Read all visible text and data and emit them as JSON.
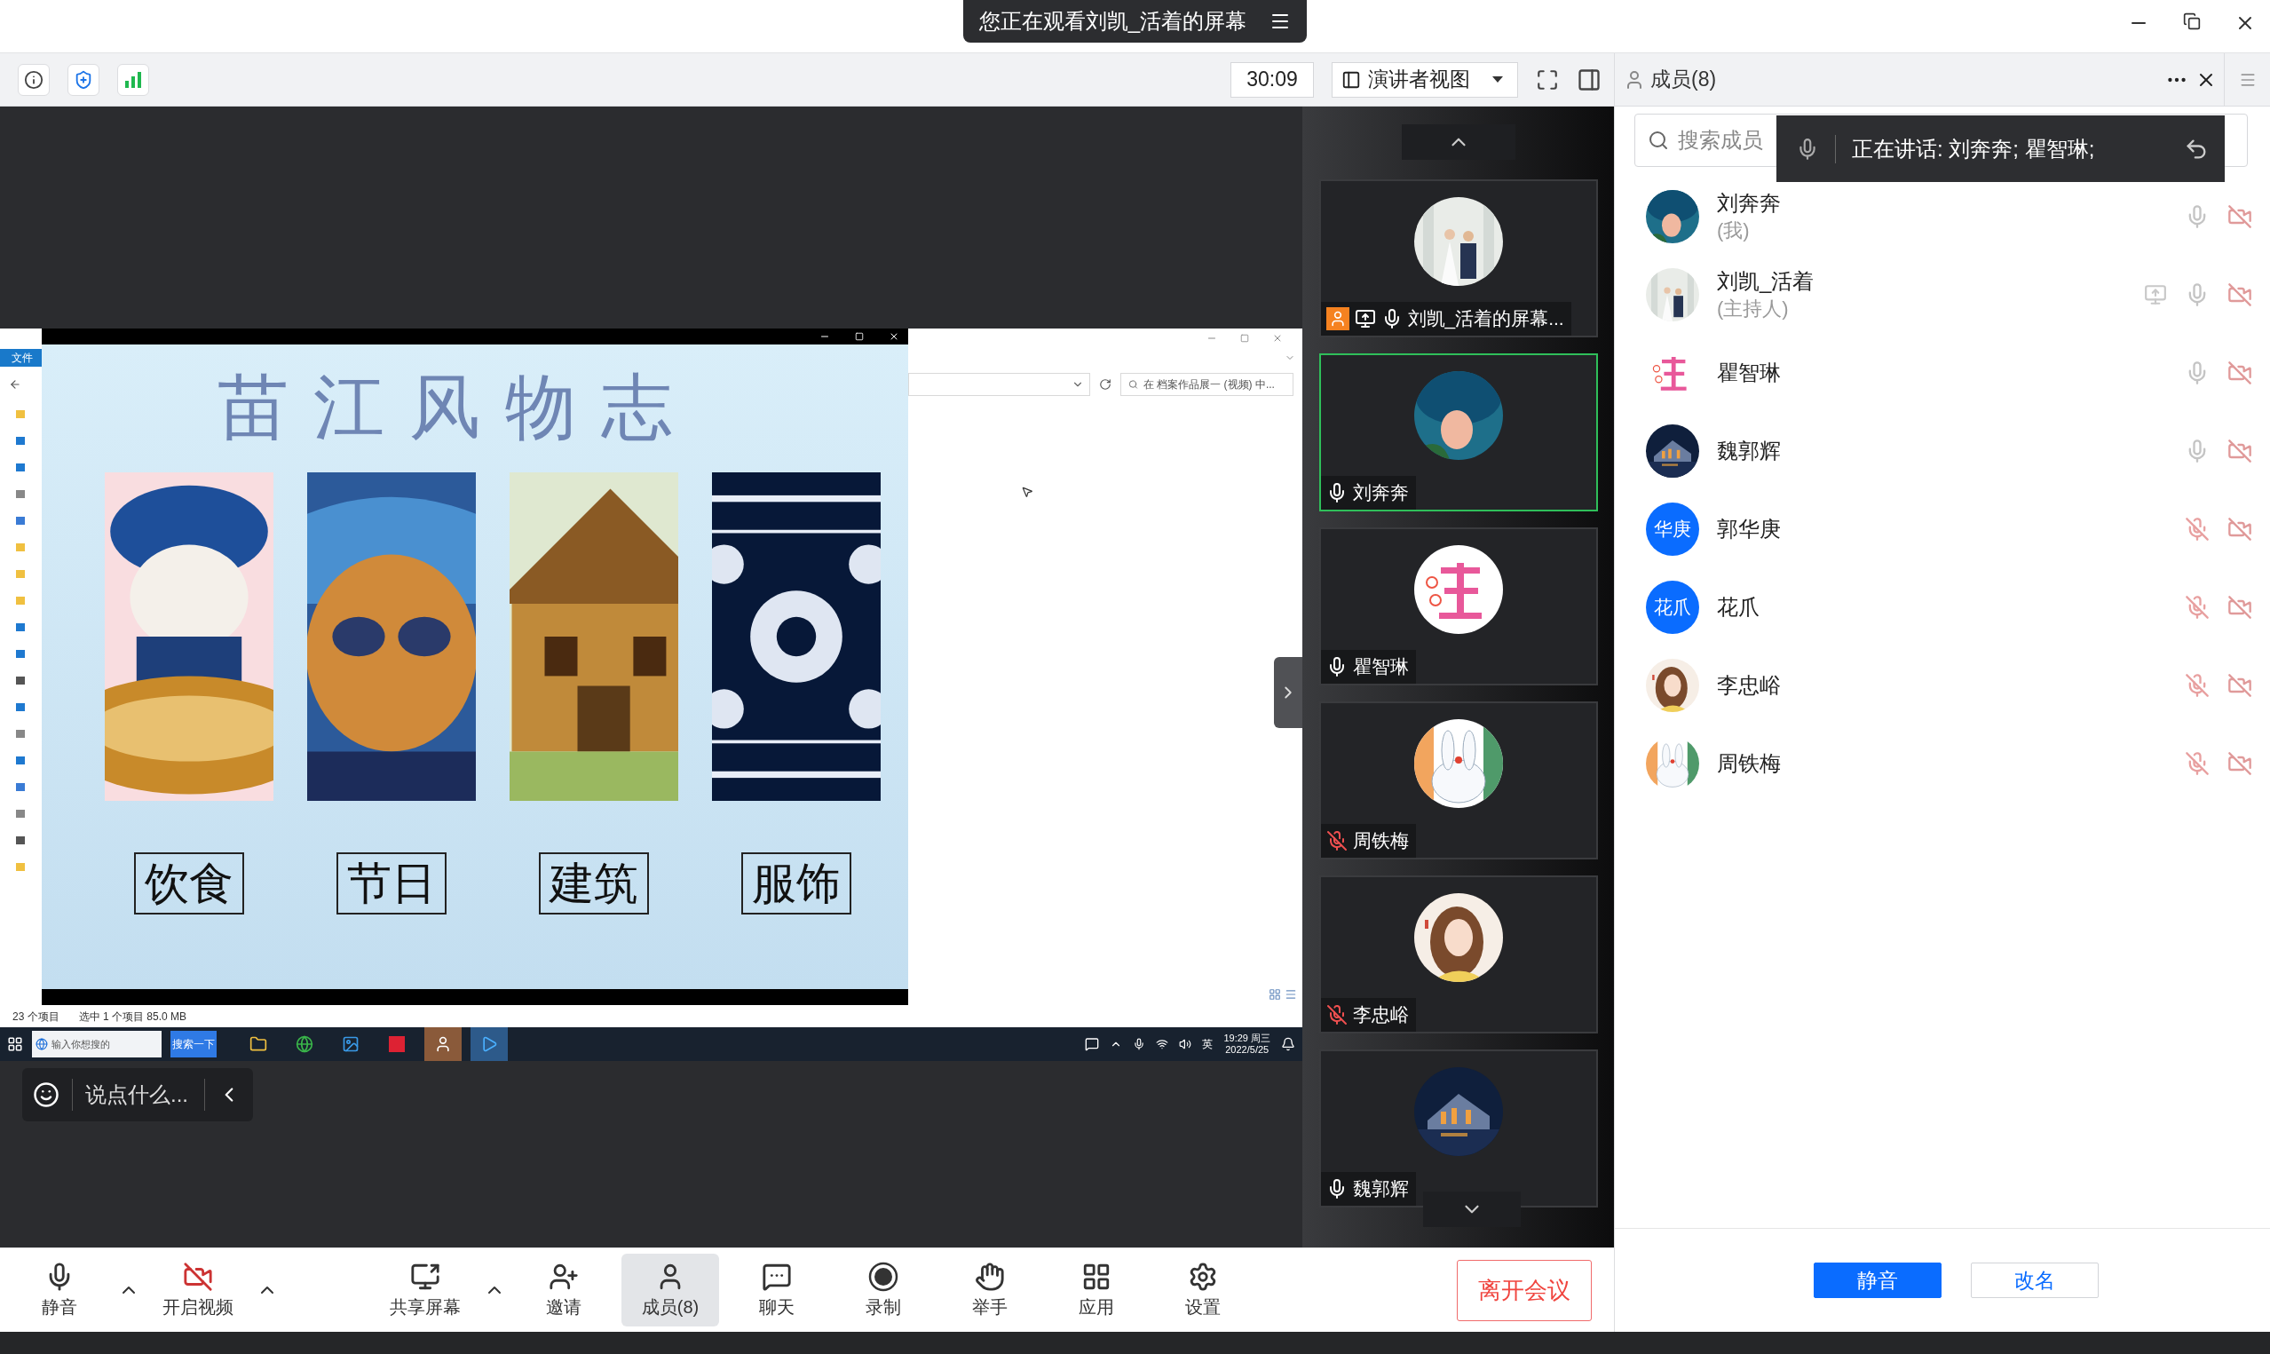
{
  "title_bar": {
    "banner": "您正在观看刘凯_活着的屏幕"
  },
  "meeting_toolbar": {
    "timer": "30:09",
    "view_button": "演讲者视图"
  },
  "shared_screen": {
    "explorer": {
      "ribbon_tab": "文件",
      "search_placeholder": "在 档案作品展一 (视频) 中...",
      "item_count": "23 个项目",
      "selection": "选中 1 个项目  85.0 MB"
    },
    "slide": {
      "title": "苗江风物志",
      "cards": [
        {
          "label": "饮食"
        },
        {
          "label": "节日"
        },
        {
          "label": "建筑"
        },
        {
          "label": "服饰"
        }
      ]
    },
    "taskbar": {
      "search_placeholder": "输入你想搜的",
      "search_button": "搜索一下",
      "input_method": "英",
      "time": "19:29 周三",
      "date": "2022/5/25"
    }
  },
  "chat_input": {
    "placeholder": "说点什么..."
  },
  "video_strip": {
    "tiles": [
      {
        "name": "刘凯_活着的屏幕...",
        "kind": "screen",
        "mic_muted": false,
        "selected": false
      },
      {
        "name": "刘奔奔",
        "kind": "camera",
        "mic_muted": false,
        "selected": true
      },
      {
        "name": "瞿智琳",
        "kind": "camera",
        "mic_muted": false,
        "selected": false
      },
      {
        "name": "周铁梅",
        "kind": "camera",
        "mic_muted": true,
        "selected": false
      },
      {
        "name": "李忠峪",
        "kind": "camera",
        "mic_muted": true,
        "selected": false
      },
      {
        "name": "魏郭辉",
        "kind": "camera",
        "mic_muted": false,
        "selected": false
      }
    ]
  },
  "members_panel": {
    "title": "成员(8)",
    "search_placeholder": "搜索成员",
    "speaking_tip": "正在讲话: 刘奔奔; 瞿智琳;",
    "members": [
      {
        "name": "刘奔奔",
        "role": "(我)",
        "sharing": false,
        "mic_muted": false
      },
      {
        "name": "刘凯_活着",
        "role": "(主持人)",
        "sharing": true,
        "mic_muted": false
      },
      {
        "name": "瞿智琳",
        "sharing": false,
        "mic_muted": false
      },
      {
        "name": "魏郭辉",
        "sharing": false,
        "mic_muted": false
      },
      {
        "name": "郭华庚",
        "avatar": {
          "kind": "initials",
          "text": "华庚"
        },
        "sharing": false,
        "mic_muted": true
      },
      {
        "name": "花爪",
        "avatar": {
          "kind": "initials",
          "text": "花爪"
        },
        "sharing": false,
        "mic_muted": true
      },
      {
        "name": "李忠峪",
        "sharing": false,
        "mic_muted": true
      },
      {
        "name": "周铁梅",
        "sharing": false,
        "mic_muted": true
      }
    ],
    "buttons": [
      {
        "label": "静音",
        "primary": true
      },
      {
        "label": "改名",
        "primary": false
      }
    ]
  },
  "bottom_toolbar": {
    "groups": [
      [
        {
          "kind": "mic",
          "label": "静音",
          "caret": true,
          "selected": false
        },
        {
          "kind": "video_off",
          "label": "开启视频",
          "caret": true,
          "selected": false
        }
      ],
      [
        {
          "kind": "share",
          "label": "共享屏幕",
          "caret": true,
          "selected": false
        },
        {
          "kind": "invite",
          "label": "邀请",
          "caret": false,
          "selected": false
        },
        {
          "kind": "members",
          "label": "成员(8)",
          "caret": false,
          "selected": true
        },
        {
          "kind": "chat",
          "label": "聊天",
          "caret": false,
          "selected": false
        },
        {
          "kind": "record",
          "label": "录制",
          "caret": false,
          "selected": false
        },
        {
          "kind": "hand",
          "label": "举手",
          "caret": false,
          "selected": false
        },
        {
          "kind": "apps",
          "label": "应用",
          "caret": false,
          "selected": false
        },
        {
          "kind": "settings",
          "label": "设置",
          "caret": false,
          "selected": false
        }
      ]
    ],
    "leave_button": "离开会议"
  }
}
